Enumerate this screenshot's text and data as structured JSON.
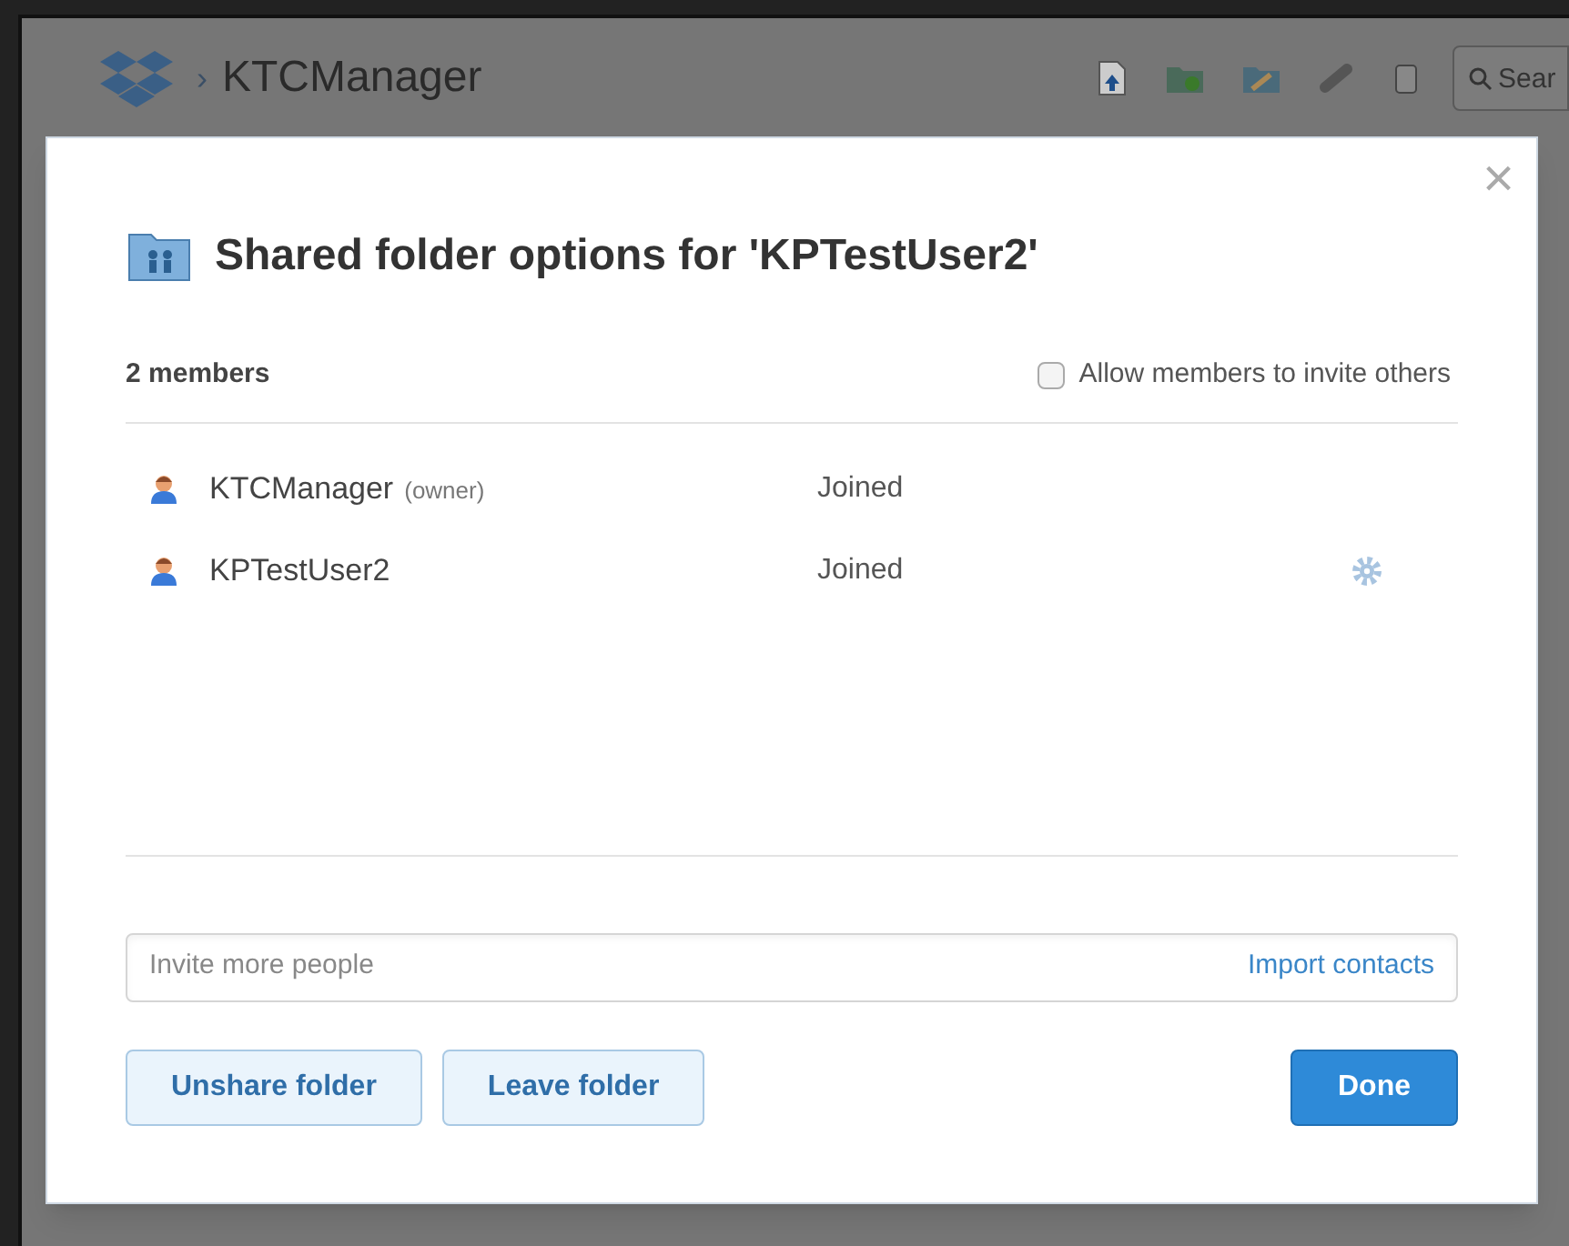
{
  "header": {
    "breadcrumb_separator": "›",
    "folder": "KTCManager",
    "search": {
      "placeholder": "Sear"
    }
  },
  "dialog": {
    "close": "×",
    "title": "Shared folder options for 'KPTestUser2'",
    "member_count": "2 members",
    "allow_invite": {
      "label": "Allow members to invite others",
      "checked": false
    },
    "members": [
      {
        "name": "KTCManager",
        "role": "(owner)",
        "status": "Joined",
        "settings": false
      },
      {
        "name": "KPTestUser2",
        "status": "Joined",
        "settings": true
      }
    ],
    "invite": {
      "placeholder": "Invite more people",
      "link": "Import contacts"
    },
    "buttons": [
      {
        "label": "Unshare folder",
        "kind": "secondary"
      },
      {
        "label": "Leave folder",
        "kind": "secondary"
      },
      {
        "label": "Done",
        "kind": "primary"
      }
    ]
  }
}
